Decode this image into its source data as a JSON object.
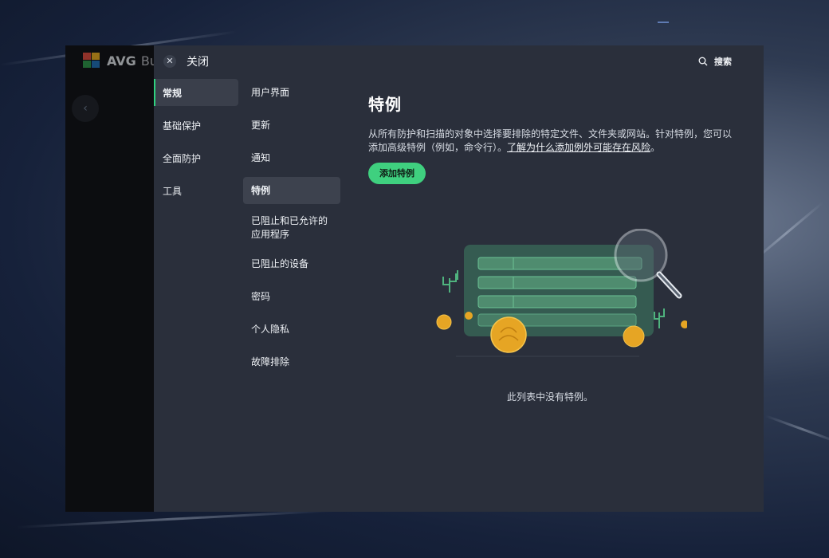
{
  "app": {
    "logo_text": "AVG",
    "logo_text2": "Bus"
  },
  "panel": {
    "close_label": "关闭",
    "search_label": "搜索"
  },
  "nav_primary": [
    {
      "label": "常规",
      "active": true
    },
    {
      "label": "基础保护",
      "active": false
    },
    {
      "label": "全面防护",
      "active": false
    },
    {
      "label": "工具",
      "active": false
    }
  ],
  "nav_secondary": [
    {
      "label": "用户界面",
      "active": false
    },
    {
      "label": "更新",
      "active": false
    },
    {
      "label": "通知",
      "active": false
    },
    {
      "label": "特例",
      "active": true
    },
    {
      "label": "已阻止和已允许的应用程序",
      "active": false
    },
    {
      "label": "已阻止的设备",
      "active": false
    },
    {
      "label": "密码",
      "active": false
    },
    {
      "label": "个人隐私",
      "active": false
    },
    {
      "label": "故障排除",
      "active": false
    }
  ],
  "content": {
    "title": "特例",
    "description": "从所有防护和扫描的对象中选择要排除的特定文件、文件夹或网站。针对特例，您可以添加高级特例（例如，命令行）。",
    "description_link": "了解为什么添加例外可能存在风险",
    "description_end": "。",
    "add_button": "添加特例",
    "empty_text": "此列表中没有特例。"
  },
  "colors": {
    "accent": "#3fd07f",
    "panel_bg": "#2a2f3b",
    "active_bg": "#3d424e"
  },
  "icons": {
    "close": "close-icon",
    "search": "search-icon",
    "back": "chevron-left-icon",
    "logo": "avg-logo-icon"
  }
}
